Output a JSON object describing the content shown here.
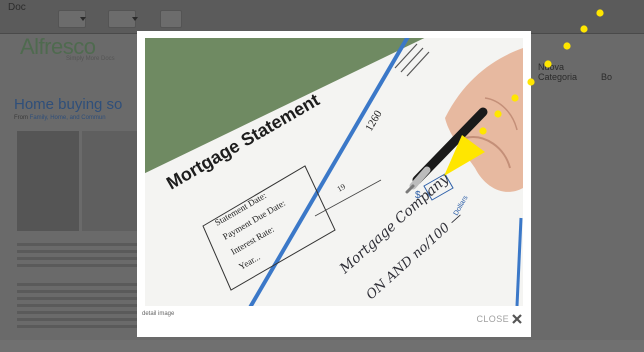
{
  "background_page": {
    "toolbar_label": "Doc",
    "logo_text": "Alfresco",
    "logo_subtitle": "Simply More Docs",
    "nav_items": [
      "Nuova Categoria",
      "Bo"
    ],
    "article_title": "Home buying so",
    "article_meta_prefix": "From",
    "article_meta_links": "Family, Home, and Commun"
  },
  "modal": {
    "photo": {
      "document_title": "Mortgage Statement",
      "field_labels": [
        "Statement Date:",
        "Payment Due Date:",
        "Interest Rate:",
        "Year..."
      ],
      "check_number": "1260",
      "year_prefix": "19",
      "dollar_sign": "$",
      "dollars_label": "Dollars",
      "handwriting_line1": "Mortgage Company",
      "handwriting_line2": "ON AND no/100 —"
    },
    "caption": "detail image",
    "close_label": "CLOSE"
  },
  "colors": {
    "overlay": "#3a3a3a",
    "modal_bg": "#ffffff",
    "annotation": "#ffe600",
    "accent_line": "#3b78c8"
  },
  "icons": {
    "close": "close-icon",
    "arrow": "pointer-arrow-icon"
  }
}
